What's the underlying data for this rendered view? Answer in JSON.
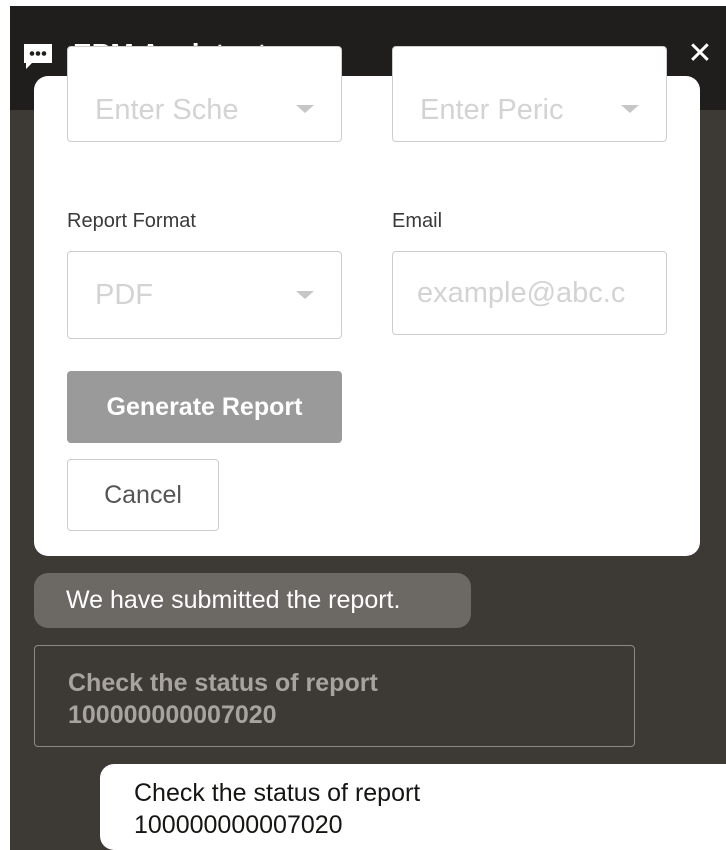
{
  "header": {
    "title": "EPM Assistant",
    "more_label": "···",
    "close_label": "✕",
    "chat_icon": "chat-bubble-icon"
  },
  "form": {
    "schedule_placeholder": "Enter Sche",
    "period_placeholder": "Enter Peric",
    "report_format_label": "Report Format",
    "report_format_value": "PDF",
    "email_label": "Email",
    "email_placeholder": "example@abc.c",
    "generate_label": "Generate Report",
    "cancel_label": "Cancel"
  },
  "messages": {
    "bot": "We have submitted the report.",
    "action_line1": "Check the status of report",
    "action_line2": "100000000007020",
    "user_line1": "Check the status of report",
    "user_line2": "100000000007020"
  },
  "colors": {
    "header_bg": "#201e1c",
    "chat_bg": "#3d3935",
    "bot_bubble": "#6c6864",
    "button_disabled": "#9a9a9a"
  }
}
